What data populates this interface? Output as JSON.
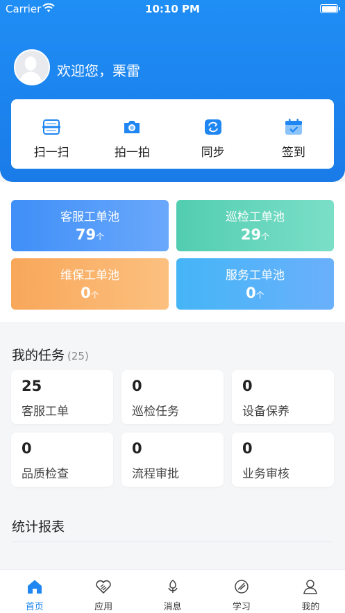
{
  "status_bar": {
    "carrier": "Carrier",
    "time": "10:10 PM"
  },
  "user": {
    "greeting": "欢迎您，栗雷"
  },
  "quick_actions": [
    {
      "label": "扫一扫",
      "icon": "scan-icon"
    },
    {
      "label": "拍一拍",
      "icon": "camera-icon"
    },
    {
      "label": "同步",
      "icon": "sync-icon"
    },
    {
      "label": "签到",
      "icon": "calendar-check-icon"
    }
  ],
  "pools": [
    {
      "title": "客服工单池",
      "count": "79",
      "unit": "个"
    },
    {
      "title": "巡检工单池",
      "count": "29",
      "unit": "个"
    },
    {
      "title": "维保工单池",
      "count": "0",
      "unit": "个"
    },
    {
      "title": "服务工单池",
      "count": "0",
      "unit": "个"
    }
  ],
  "tasks": {
    "title": "我的任务",
    "count": "(25)",
    "items": [
      {
        "num": "25",
        "label": "客服工单"
      },
      {
        "num": "0",
        "label": "巡检任务"
      },
      {
        "num": "0",
        "label": "设备保养"
      },
      {
        "num": "0",
        "label": "品质检查"
      },
      {
        "num": "0",
        "label": "流程审批"
      },
      {
        "num": "0",
        "label": "业务审核"
      }
    ]
  },
  "reports": {
    "title": "统计报表"
  },
  "tabbar": [
    {
      "label": "首页",
      "icon": "home-icon",
      "active": true
    },
    {
      "label": "应用",
      "icon": "apps-icon"
    },
    {
      "label": "消息",
      "icon": "message-icon"
    },
    {
      "label": "学习",
      "icon": "study-icon"
    },
    {
      "label": "我的",
      "icon": "profile-icon"
    }
  ],
  "colors": {
    "primary": "#1f86f2",
    "accent_green": "#52cdb0",
    "accent_orange": "#f8a75a",
    "accent_sky": "#45b5f7"
  }
}
